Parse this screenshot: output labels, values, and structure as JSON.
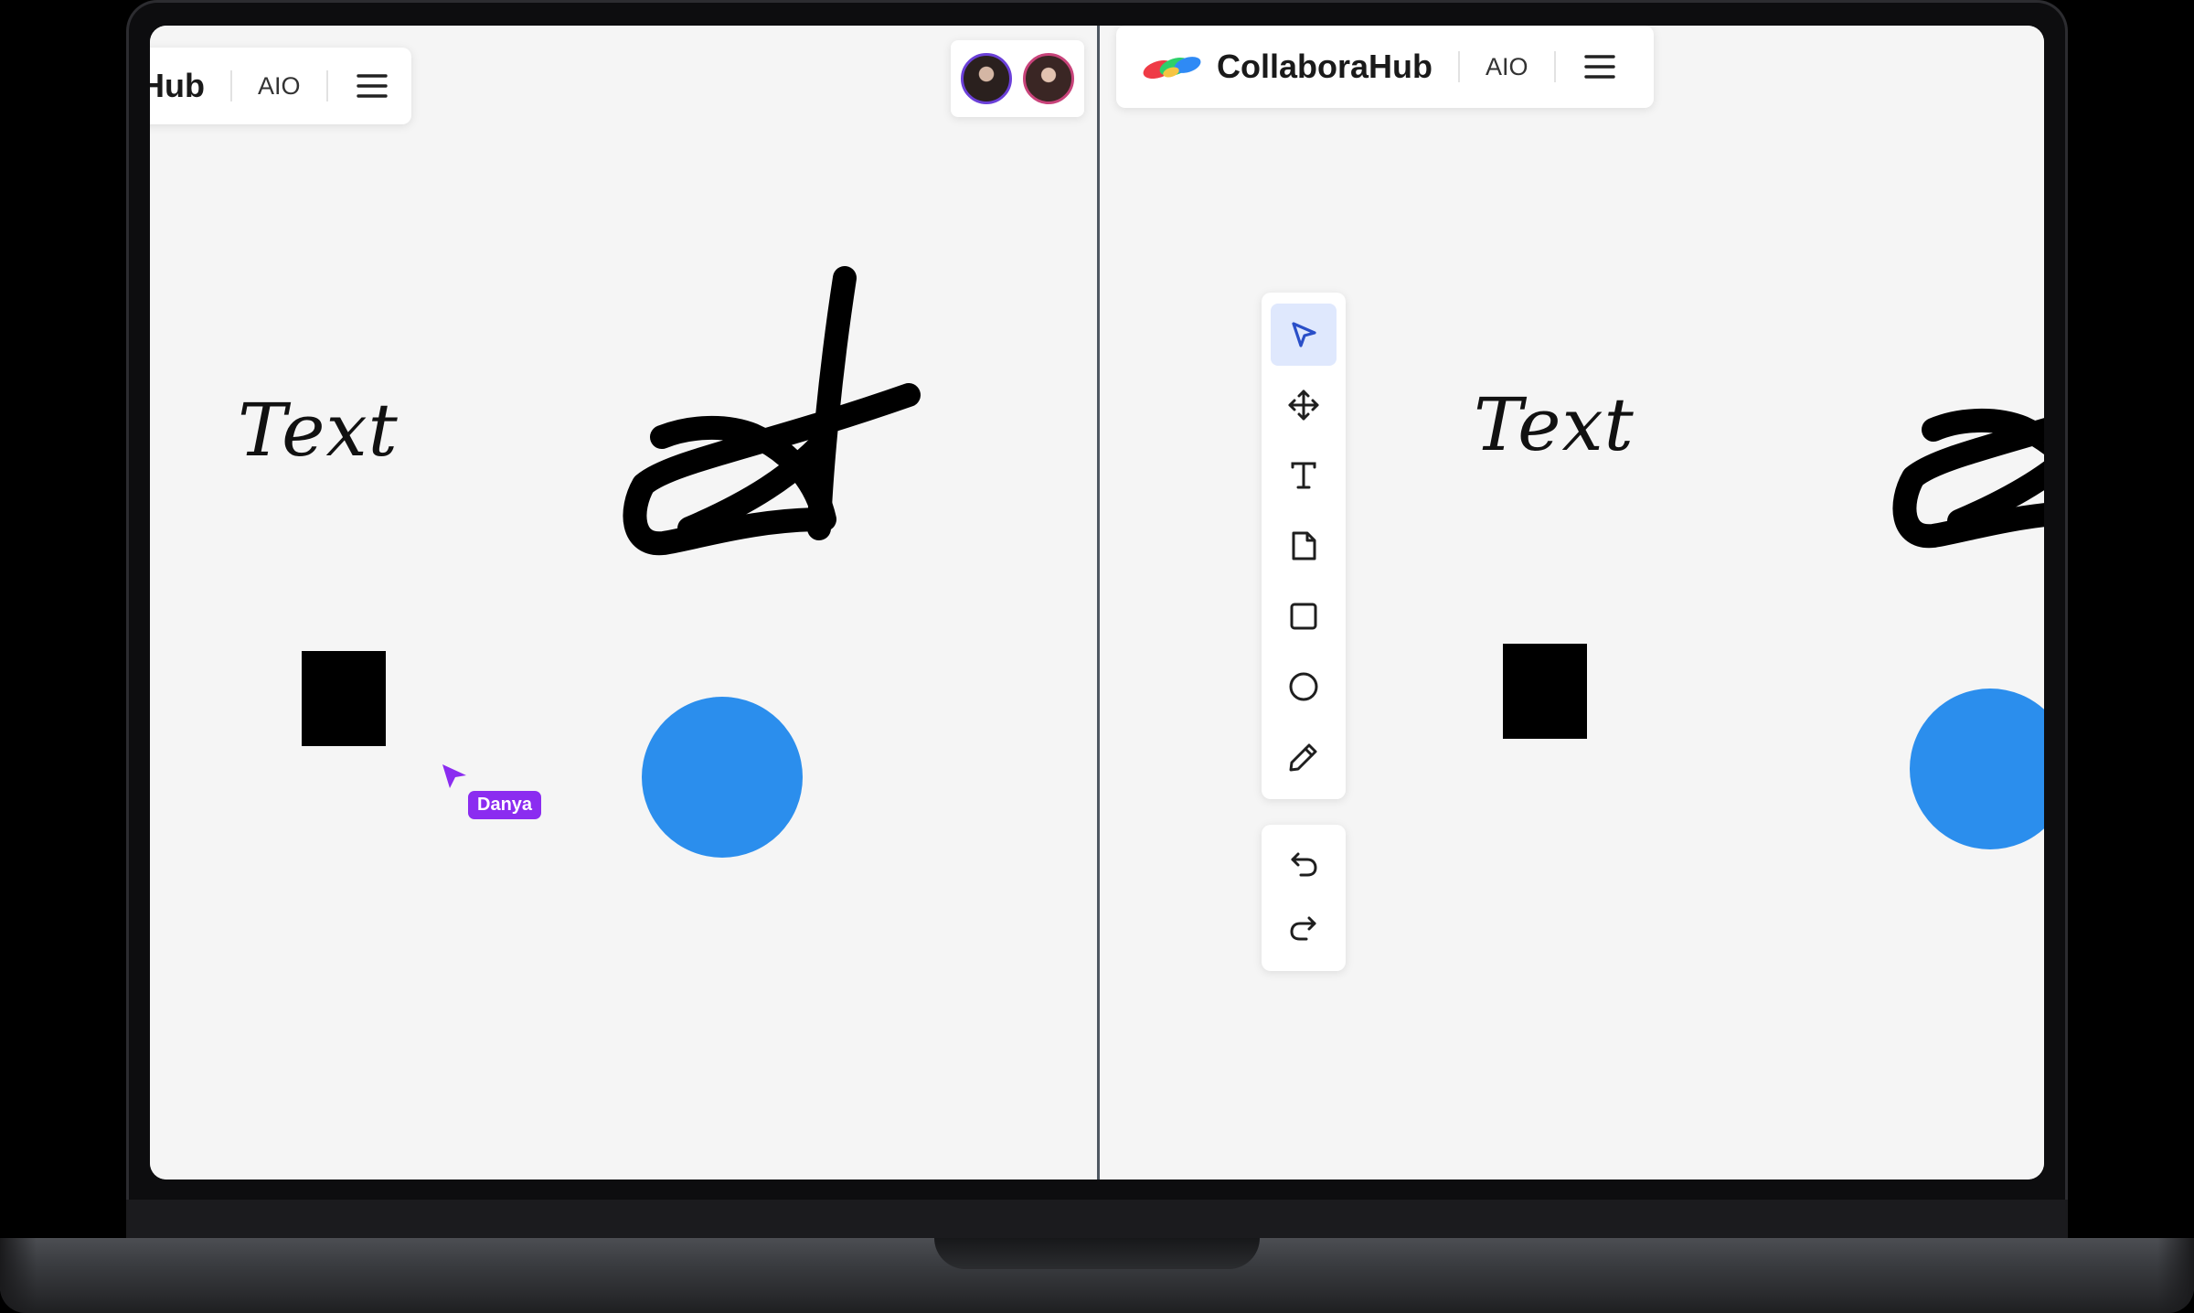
{
  "left_pane": {
    "brand_partial": "Hub",
    "mode": "AIO",
    "canvas_text": "Text",
    "cursor_label": "Danya"
  },
  "right_pane": {
    "brand": "CollaboraHub",
    "mode": "AIO",
    "canvas_text": "Text"
  },
  "collaborators": [
    {
      "name": "collaborator-1",
      "ring_color": "#6b40d8"
    },
    {
      "name": "collaborator-2",
      "ring_color": "#c8437a"
    }
  ],
  "toolbar": {
    "tools": [
      "select-icon",
      "move-icon",
      "text-icon",
      "note-icon",
      "rectangle-icon",
      "ellipse-icon",
      "pencil-icon"
    ],
    "active_tool": "select-icon",
    "history": [
      "undo-icon",
      "redo-icon"
    ]
  },
  "colors": {
    "canvas_bg": "#f5f5f5",
    "circle": "#2b8eed",
    "cursor": "#8b2cf0",
    "active_tool_bg": "#dfe8fd",
    "logo_red": "#ef3b46",
    "logo_green": "#2dd06a",
    "logo_blue": "#2f8af5",
    "logo_yellow": "#f6c542"
  }
}
